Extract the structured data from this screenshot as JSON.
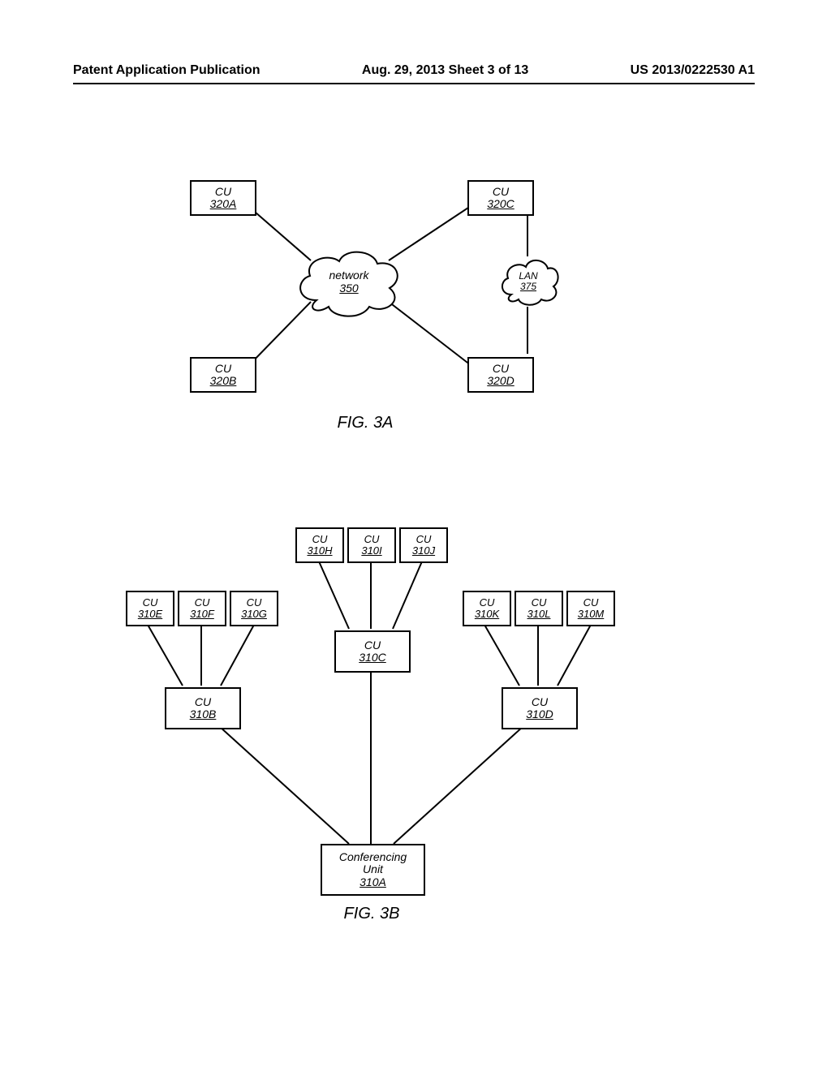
{
  "header": {
    "left": "Patent Application Publication",
    "center": "Aug. 29, 2013  Sheet 3 of 13",
    "right": "US 2013/0222530 A1"
  },
  "figA": {
    "caption": "FIG. 3A",
    "nodes": {
      "cu320a": {
        "top": "CU",
        "bottom": "320A"
      },
      "cu320b": {
        "top": "CU",
        "bottom": "320B"
      },
      "cu320c": {
        "top": "CU",
        "bottom": "320C"
      },
      "cu320d": {
        "top": "CU",
        "bottom": "320D"
      },
      "network": {
        "top": "network",
        "bottom": "350"
      },
      "lan": {
        "top": "LAN",
        "bottom": "375"
      }
    }
  },
  "figB": {
    "caption": "FIG. 3B",
    "nodes": {
      "cu310a": {
        "top": "Conferencing\nUnit",
        "bottom": "310A"
      },
      "cu310b": {
        "top": "CU",
        "bottom": "310B"
      },
      "cu310c": {
        "top": "CU",
        "bottom": "310C"
      },
      "cu310d": {
        "top": "CU",
        "bottom": "310D"
      },
      "cu310e": {
        "top": "CU",
        "bottom": "310E"
      },
      "cu310f": {
        "top": "CU",
        "bottom": "310F"
      },
      "cu310g": {
        "top": "CU",
        "bottom": "310G"
      },
      "cu310h": {
        "top": "CU",
        "bottom": "310H"
      },
      "cu310i": {
        "top": "CU",
        "bottom": "310I"
      },
      "cu310j": {
        "top": "CU",
        "bottom": "310J"
      },
      "cu310k": {
        "top": "CU",
        "bottom": "310K"
      },
      "cu310l": {
        "top": "CU",
        "bottom": "310L"
      },
      "cu310m": {
        "top": "CU",
        "bottom": "310M"
      }
    }
  }
}
